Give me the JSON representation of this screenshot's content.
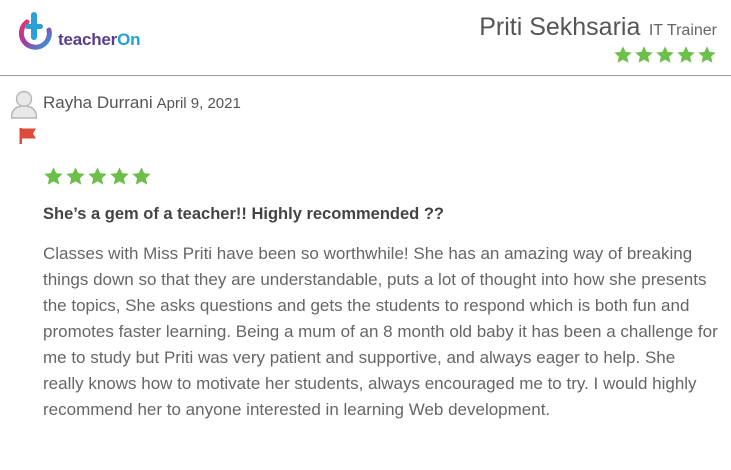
{
  "header": {
    "logo": {
      "part1": "teacher",
      "part2": "On",
      "icon": "teacheron-logo-icon"
    },
    "trainer": {
      "name": "Priti Sekhsaria",
      "role": "IT Trainer",
      "rating": 5,
      "star_color": "#6cc04a"
    }
  },
  "review": {
    "reviewer_name": "Rayha Durrani",
    "date": "April 9, 2021",
    "avatar_icon": "user-avatar-icon",
    "flag_icon": "flag-icon",
    "flag_color": "#e04a3a",
    "rating": 5,
    "title": "She’s a gem of a teacher!! Highly recommended ??",
    "body": "Classes with Miss Priti have been so worthwhile! She has an amazing way of breaking things down so that they are understandable, puts a lot of thought into how she presents the topics, She asks questions and gets the students to respond which is both fun and promotes faster learning. Being a mum of an 8 month old baby it has been a challenge for me to study but Priti was very patient and supportive, and always eager to help. She really knows how to motivate her students, always encouraged me to try. I would highly recommend her to anyone interested in learning Web development."
  }
}
